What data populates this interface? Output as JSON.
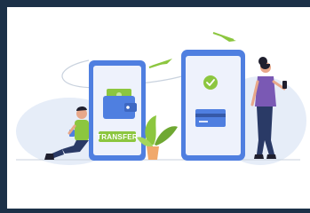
{
  "illustration": {
    "transfer_label": "TRANSFER",
    "icons": [
      "wallet-icon",
      "banknote-icon",
      "check-icon",
      "credit-card-icon",
      "arrow-icon",
      "plant-icon"
    ],
    "colors": {
      "frame": "#1c3148",
      "background": "#ffffff",
      "phone": "#4f7fe0",
      "phone_screen": "#eef2fc",
      "accent_green": "#8cc63f",
      "blob": "#e6edf8",
      "skin": "#e8a88a",
      "hair": "#1f1f2e"
    }
  }
}
